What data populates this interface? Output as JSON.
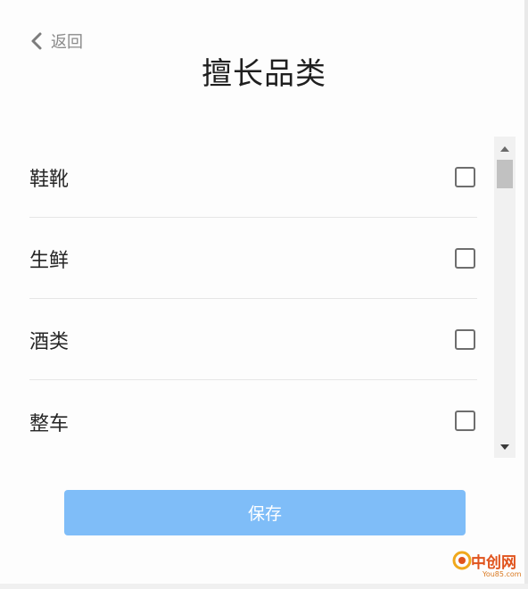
{
  "header": {
    "back_label": "返回",
    "title": "擅长品类"
  },
  "categories": [
    {
      "label": "鞋靴",
      "checked": false
    },
    {
      "label": "生鲜",
      "checked": false
    },
    {
      "label": "酒类",
      "checked": false
    },
    {
      "label": "整车",
      "checked": false
    }
  ],
  "footer": {
    "save_label": "保存"
  },
  "watermark": {
    "brand": "中创网",
    "domain": "You85.com"
  },
  "colors": {
    "primary_button": "#7fbdf8",
    "watermark": "#e0531c"
  }
}
